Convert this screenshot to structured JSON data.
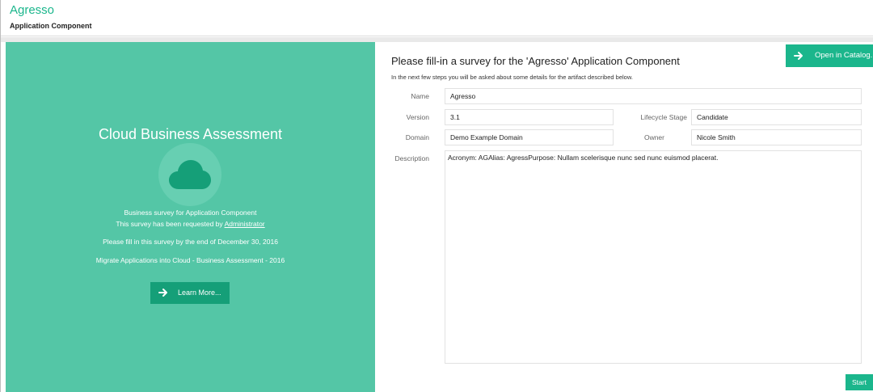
{
  "header": {
    "title": "Agresso",
    "subtitle": "Application Component"
  },
  "left_panel": {
    "heading": "Cloud Business Assessment",
    "icon": "cloud-icon",
    "line1": "Business survey for Application Component",
    "line2_prefix": "This survey has been requested by ",
    "line2_link": "Administrator",
    "line3": "Please fill in this survey by the end of December 30, 2016",
    "line4": "Migrate Applications into Cloud - Business Assessment - 2016",
    "learn_more_label": "Learn More..."
  },
  "form": {
    "open_catalog_label": "Open in Catalog...",
    "title": "Please fill-in a survey for the 'Agresso' Application Component",
    "intro": "In the next few steps you will be asked about some details for the artifact described below.",
    "fields": {
      "name": {
        "label": "Name",
        "value": "Agresso"
      },
      "version": {
        "label": "Version",
        "value": "3.1"
      },
      "lifecycle_stage": {
        "label": "Lifecycle Stage",
        "value": "Candidate"
      },
      "domain": {
        "label": "Domain",
        "value": "Demo Example Domain"
      },
      "owner": {
        "label": "Owner",
        "value": "Nicole Smith"
      },
      "description": {
        "label": "Description",
        "value": "Acronym: AGAlias: AgressPurpose: Nullam scelerisque nunc sed nunc euismod placerat."
      }
    },
    "start_label": "Start"
  },
  "colors": {
    "accent": "#1bb68c",
    "panel": "#54c6a6",
    "button_dark": "#159f78"
  }
}
